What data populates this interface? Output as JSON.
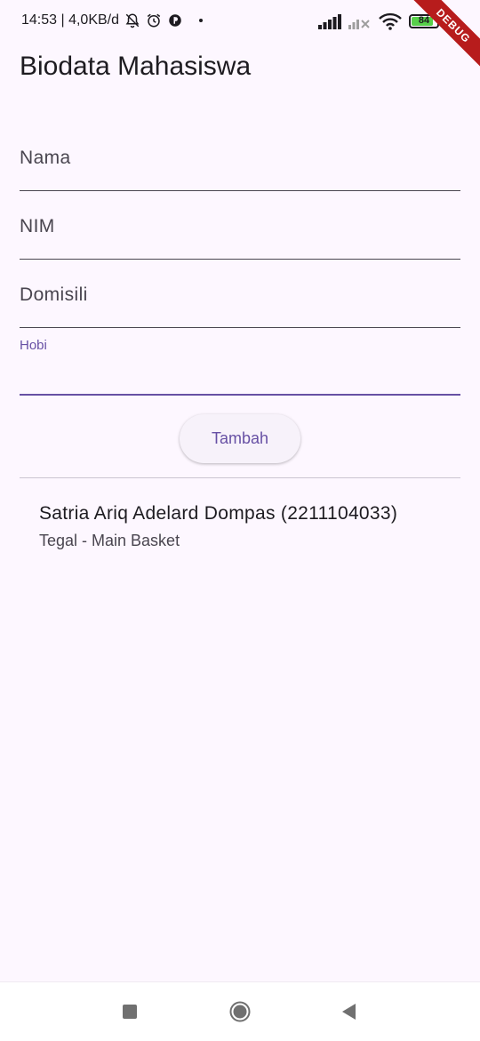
{
  "status_bar": {
    "time_info": "14:53 | 4,0KB/d",
    "battery": "84"
  },
  "debug_banner": "DEBUG",
  "app_bar": {
    "title": "Biodata Mahasiswa"
  },
  "form": {
    "nama_label": "Nama",
    "nim_label": "NIM",
    "domisili_label": "Domisili",
    "hobi_label": "Hobi",
    "submit_label": "Tambah"
  },
  "list": {
    "items": [
      {
        "title": "Satria Ariq Adelard Dompas (2211104033)",
        "subtitle": "Tegal - Main Basket"
      }
    ]
  },
  "colors": {
    "background": "#fdf7ff",
    "primary": "#6750a4",
    "on_surface": "#1d1b20",
    "on_surface_variant": "#49454f",
    "battery_fill": "#57d04a",
    "debug_banner": "#b71c1c"
  }
}
